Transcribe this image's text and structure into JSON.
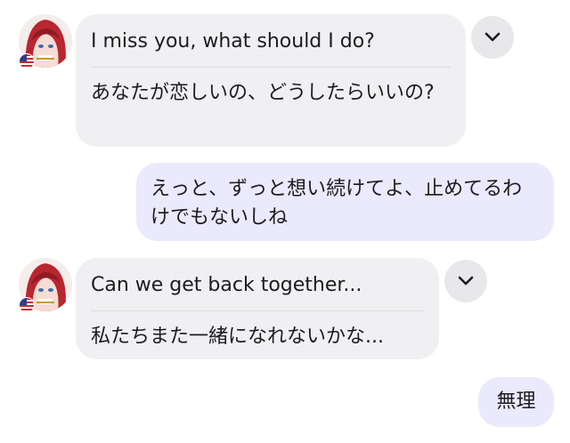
{
  "messages": [
    {
      "sender": "partner",
      "text": "I miss you, what should I do?",
      "translation": "あなたが恋しいの、どうしたらいいの?",
      "flag_icon": "us-flag-icon",
      "action_icon": "chevron-down-icon"
    },
    {
      "sender": "me",
      "text": "えっと、ずっと想い続けてよ、止めてるわけでもないしね"
    },
    {
      "sender": "partner",
      "text": "Can we get back together...",
      "translation": "私たちまた一緒になれないかな...",
      "flag_icon": "us-flag-icon",
      "action_icon": "chevron-down-icon"
    },
    {
      "sender": "me",
      "text": "無理"
    }
  ],
  "colors": {
    "incoming_bubble": "#f0f0f2",
    "outgoing_bubble": "#ebe9fc",
    "divider": "#dcdce0",
    "chevron_button": "#e8e8ea",
    "avatar_hair": "#b8262f"
  }
}
